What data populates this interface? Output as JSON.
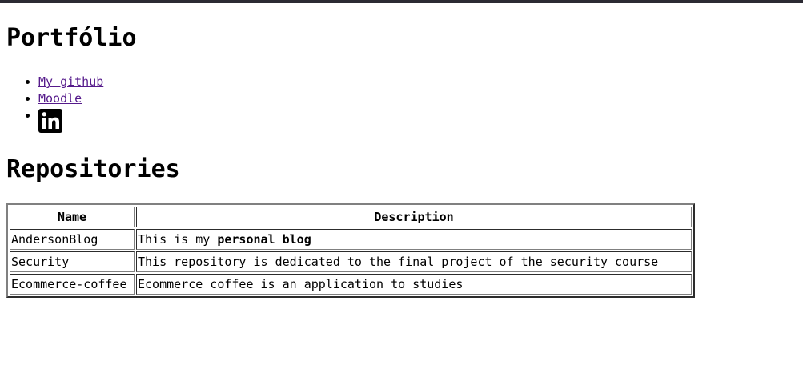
{
  "page": {
    "title": "Portfólio",
    "links": [
      {
        "label": "My github"
      },
      {
        "label": "Moodle"
      },
      {
        "icon": "linkedin-icon"
      }
    ],
    "repos_heading": "Repositories"
  },
  "table": {
    "headers": [
      "Name",
      "Description"
    ],
    "rows": [
      {
        "name": "AndersonBlog",
        "desc_prefix": "This is my ",
        "desc_bold": "personal blog"
      },
      {
        "name": "Security",
        "desc": "This repository is dedicated to the final project of the security course"
      },
      {
        "name": "Ecommerce-coffee",
        "desc": "Ecommerce coffee is an application to studies"
      }
    ]
  },
  "colors": {
    "topbar": "#2b2a33",
    "link_visited": "#551a8b"
  }
}
